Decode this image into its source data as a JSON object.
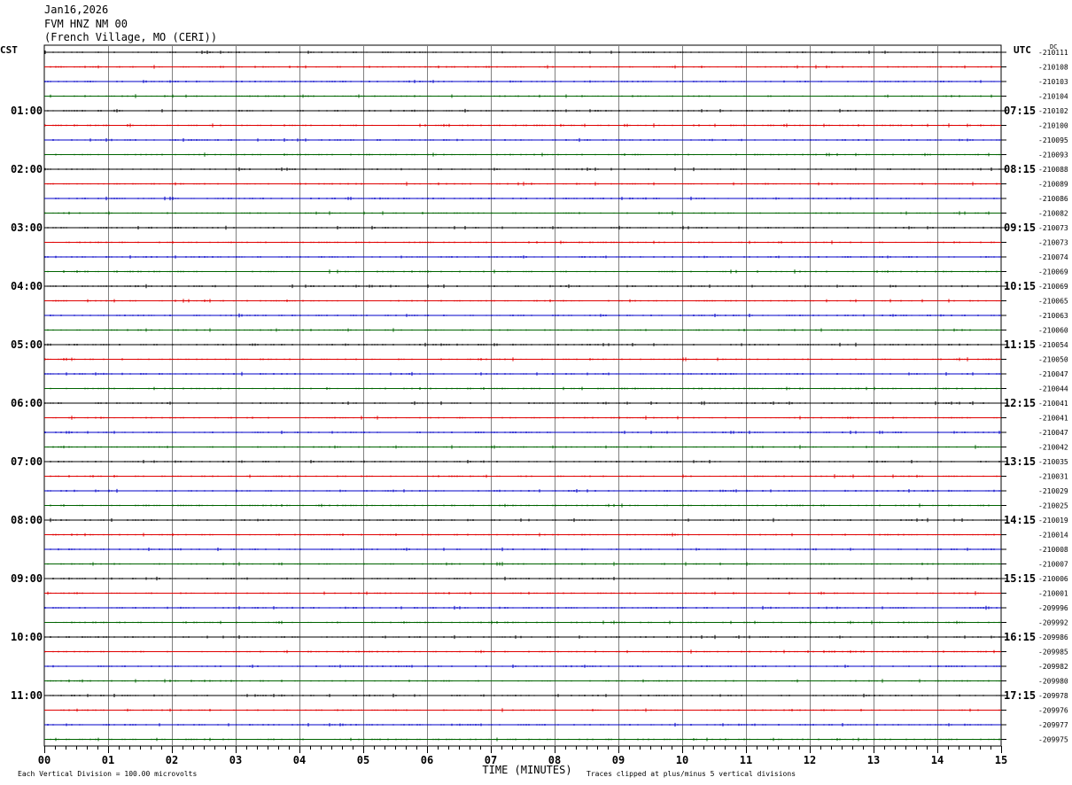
{
  "header": {
    "date": "Jan16,2026",
    "station": "FVM HNZ NM 00",
    "location": "(French Village, MO (CERI))"
  },
  "chart_data": {
    "type": "line",
    "title": "",
    "left_axis_label": "CST",
    "right_axis_label": "UTC",
    "dc_label": "DC",
    "xlabel": "TIME (MINUTES)",
    "xlim": [
      0,
      15
    ],
    "x_ticks": [
      "00",
      "01",
      "02",
      "03",
      "04",
      "05",
      "06",
      "07",
      "08",
      "09",
      "10",
      "11",
      "12",
      "13",
      "14",
      "15"
    ],
    "grid": true,
    "trace_colors": [
      "#000000",
      "#e00000",
      "#0000c8",
      "#006400"
    ],
    "cst_hour_labels": [
      "01:00",
      "02:00",
      "03:00",
      "04:00",
      "05:00",
      "06:00",
      "07:00",
      "08:00",
      "09:00",
      "10:00",
      "11:00"
    ],
    "utc_hour_labels": [
      "07:15",
      "08:15",
      "09:15",
      "10:15",
      "11:15",
      "12:15",
      "13:15",
      "14:15",
      "15:15",
      "16:15",
      "17:15"
    ],
    "dc_offsets": [
      "210111",
      "210108",
      "210103",
      "210104",
      "210102",
      "210100",
      "210095",
      "210093",
      "210088",
      "210089",
      "210086",
      "210082",
      "210073",
      "210073",
      "210074",
      "210069",
      "210069",
      "210065",
      "210063",
      "210060",
      "210054",
      "210050",
      "210047",
      "210044",
      "210041",
      "210041",
      "210047",
      "210042",
      "210035",
      "210031",
      "210029",
      "210025",
      "210019",
      "210014",
      "210008",
      "210007",
      "210006",
      "210001",
      "209996",
      "209992",
      "209986",
      "209985",
      "209982",
      "209980",
      "209978",
      "209976",
      "209977",
      "209975"
    ],
    "footer_left": "Each Vertical Division =  100.00 microvolts",
    "footer_right": "Traces clipped at plus/minus 5 vertical divisions"
  }
}
